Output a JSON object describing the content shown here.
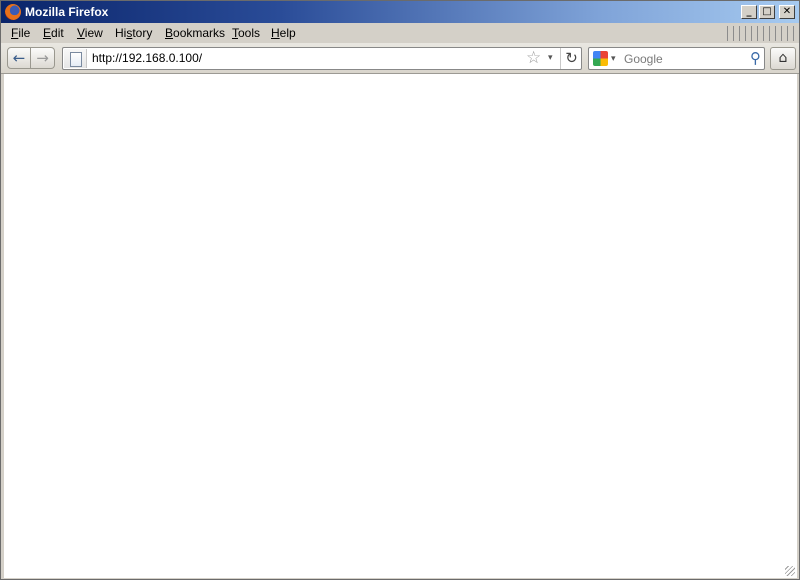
{
  "window": {
    "title": "Mozilla Firefox",
    "controls": {
      "minimize": "_",
      "maximize": "□",
      "close": "✕"
    }
  },
  "menu": {
    "items": [
      {
        "label_u": "F",
        "label_rest": "ile"
      },
      {
        "label_u": "E",
        "label_rest": "dit"
      },
      {
        "label_u": "V",
        "label_rest": "iew"
      },
      {
        "label_pre": "Hi",
        "label_u": "s",
        "label_rest": "tory"
      },
      {
        "label_u": "B",
        "label_rest": "ookmarks"
      },
      {
        "label_u": "T",
        "label_rest": "ools"
      },
      {
        "label_u": "H",
        "label_rest": "elp"
      }
    ]
  },
  "nav": {
    "back": "←",
    "forward": "→",
    "url": "http://192.168.0.100/",
    "star": "☆",
    "dropdown": "▾",
    "reload": "↻",
    "home": "⌂"
  },
  "search": {
    "placeholder": "Google",
    "dropdown": "▾",
    "go": "⚲"
  },
  "icons": {
    "browser": "firefox-logo-icon",
    "page": "blank-page-icon",
    "engine": "google-icon"
  }
}
